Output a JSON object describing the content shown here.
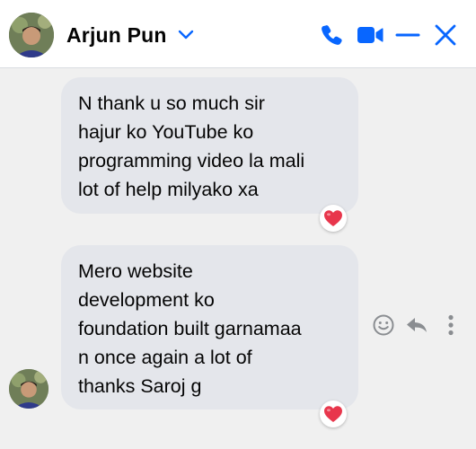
{
  "header": {
    "contact_name": "Arjun Pun",
    "icons": [
      "chevron-down-icon",
      "phone-icon",
      "video-camera-icon",
      "minimize-icon",
      "close-icon"
    ],
    "accent_color": "#0866ff"
  },
  "messages": [
    {
      "lines": [
        "N thank u so much sir",
        "hajur ko YouTube ko",
        "programming video la mali",
        "lot of help milyako xa"
      ],
      "reaction": "heart"
    },
    {
      "lines": [
        "Mero website",
        "development ko",
        "foundation built garnamaa",
        "n once again a lot of",
        "thanks Saroj g"
      ],
      "reaction": "heart"
    }
  ],
  "message_actions": [
    "smiley-icon",
    "reply-icon",
    "more-options-icon"
  ],
  "colors": {
    "background": "#f0f0f0",
    "bubble": "#e4e6eb",
    "text": "#050505",
    "heart": "#e8364c",
    "action_icon": "#8a8d91"
  }
}
